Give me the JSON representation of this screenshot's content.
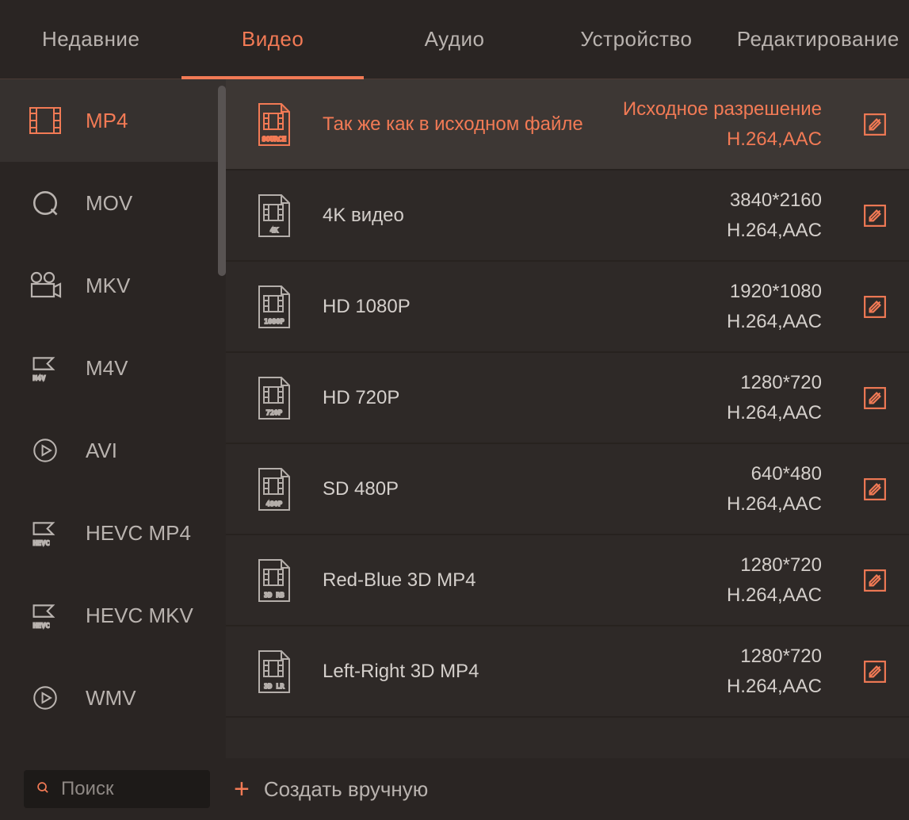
{
  "tabs": [
    {
      "id": "recent",
      "label": "Недавние",
      "active": false
    },
    {
      "id": "video",
      "label": "Видео",
      "active": true
    },
    {
      "id": "audio",
      "label": "Аудио",
      "active": false
    },
    {
      "id": "device",
      "label": "Устройство",
      "active": false
    },
    {
      "id": "editing",
      "label": "Редактирование",
      "active": false
    }
  ],
  "sidebar": [
    {
      "id": "mp4",
      "label": "MP4",
      "icon": "film",
      "tag": "",
      "selected": true
    },
    {
      "id": "mov",
      "label": "MOV",
      "icon": "qt",
      "tag": "",
      "selected": false
    },
    {
      "id": "mkv",
      "label": "MKV",
      "icon": "cam",
      "tag": "",
      "selected": false
    },
    {
      "id": "m4v",
      "label": "M4V",
      "icon": "flag",
      "tag": "M4V",
      "selected": false
    },
    {
      "id": "avi",
      "label": "AVI",
      "icon": "play",
      "tag": "",
      "selected": false
    },
    {
      "id": "hevcmp4",
      "label": "HEVC MP4",
      "icon": "flag",
      "tag": "HEVC",
      "selected": false
    },
    {
      "id": "hevcmkv",
      "label": "HEVC MKV",
      "icon": "flag",
      "tag": "HEVC",
      "selected": false
    },
    {
      "id": "wmv",
      "label": "WMV",
      "icon": "play",
      "tag": "",
      "selected": false
    }
  ],
  "presets": [
    {
      "id": "source",
      "title": "Так же как в исходном файле",
      "res": "Исходное разрешение",
      "codec": "H.264,AAC",
      "tag": "SOURCE",
      "selected": true
    },
    {
      "id": "4k",
      "title": "4K видео",
      "res": "3840*2160",
      "codec": "H.264,AAC",
      "tag": "4K",
      "selected": false
    },
    {
      "id": "1080p",
      "title": "HD 1080P",
      "res": "1920*1080",
      "codec": "H.264,AAC",
      "tag": "1080P",
      "selected": false
    },
    {
      "id": "720p",
      "title": "HD 720P",
      "res": "1280*720",
      "codec": "H.264,AAC",
      "tag": "720P",
      "selected": false
    },
    {
      "id": "480p",
      "title": "SD 480P",
      "res": "640*480",
      "codec": "H.264,AAC",
      "tag": "480P",
      "selected": false
    },
    {
      "id": "3drb",
      "title": "Red-Blue 3D MP4",
      "res": "1280*720",
      "codec": "H.264,AAC",
      "tag": "3D RB",
      "selected": false
    },
    {
      "id": "3dlr",
      "title": "Left-Right 3D MP4",
      "res": "1280*720",
      "codec": "H.264,AAC",
      "tag": "3D LR",
      "selected": false
    }
  ],
  "footer": {
    "search_placeholder": "Поиск",
    "create_label": "Создать вручную"
  }
}
